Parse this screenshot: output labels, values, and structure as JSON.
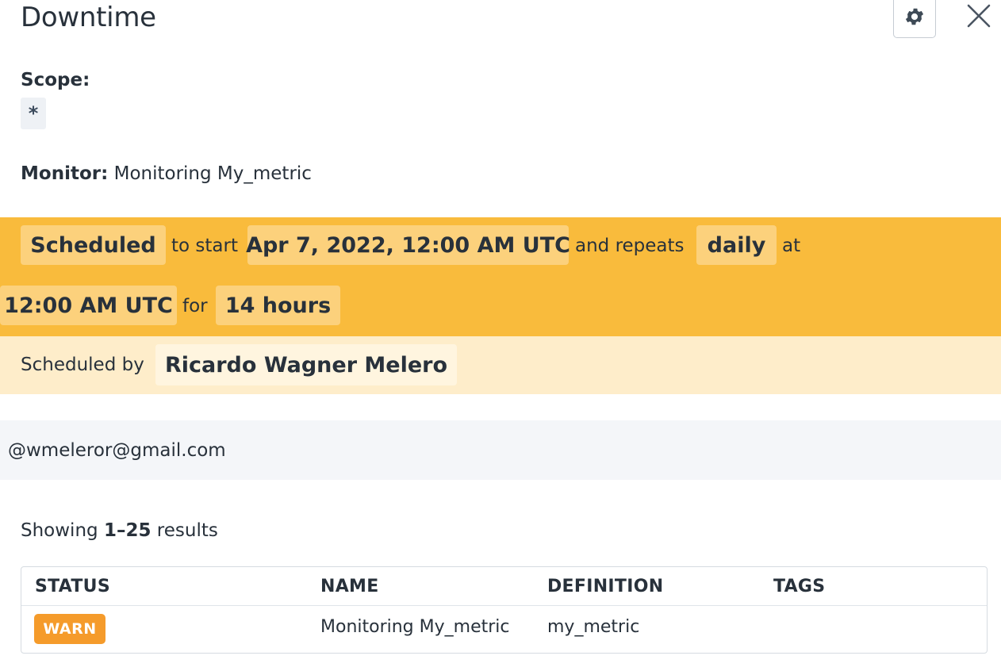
{
  "header": {
    "title": "Downtime",
    "settings_icon": "gear-icon",
    "close_icon": "close-icon"
  },
  "scope": {
    "label": "Scope:",
    "value": "*"
  },
  "monitor": {
    "label": "Monitor:",
    "value": "Monitoring My_metric"
  },
  "schedule": {
    "status": "Scheduled",
    "text_to_start": "to start",
    "start": "Apr 7, 2022, 12:00 AM UTC",
    "text_and_repeats": "and repeats",
    "repeat": "daily",
    "text_at": "at",
    "time": "12:00 AM UTC",
    "text_for": "for",
    "duration": "14 hours",
    "background_color": "#f9bb3c"
  },
  "scheduled_by": {
    "label": "Scheduled by",
    "name": "Ricardo Wagner Melero"
  },
  "message": {
    "text": "@wmeleror@gmail.com"
  },
  "results": {
    "prefix": "Showing",
    "range": "1–25",
    "suffix": "results"
  },
  "table": {
    "columns": [
      "STATUS",
      "NAME",
      "DEFINITION",
      "TAGS"
    ],
    "rows": [
      {
        "status": "WARN",
        "name": "Monitoring My_metric",
        "definition": "my_metric",
        "tags": ""
      }
    ],
    "status_colors": {
      "WARN": "#f59b2b"
    }
  }
}
